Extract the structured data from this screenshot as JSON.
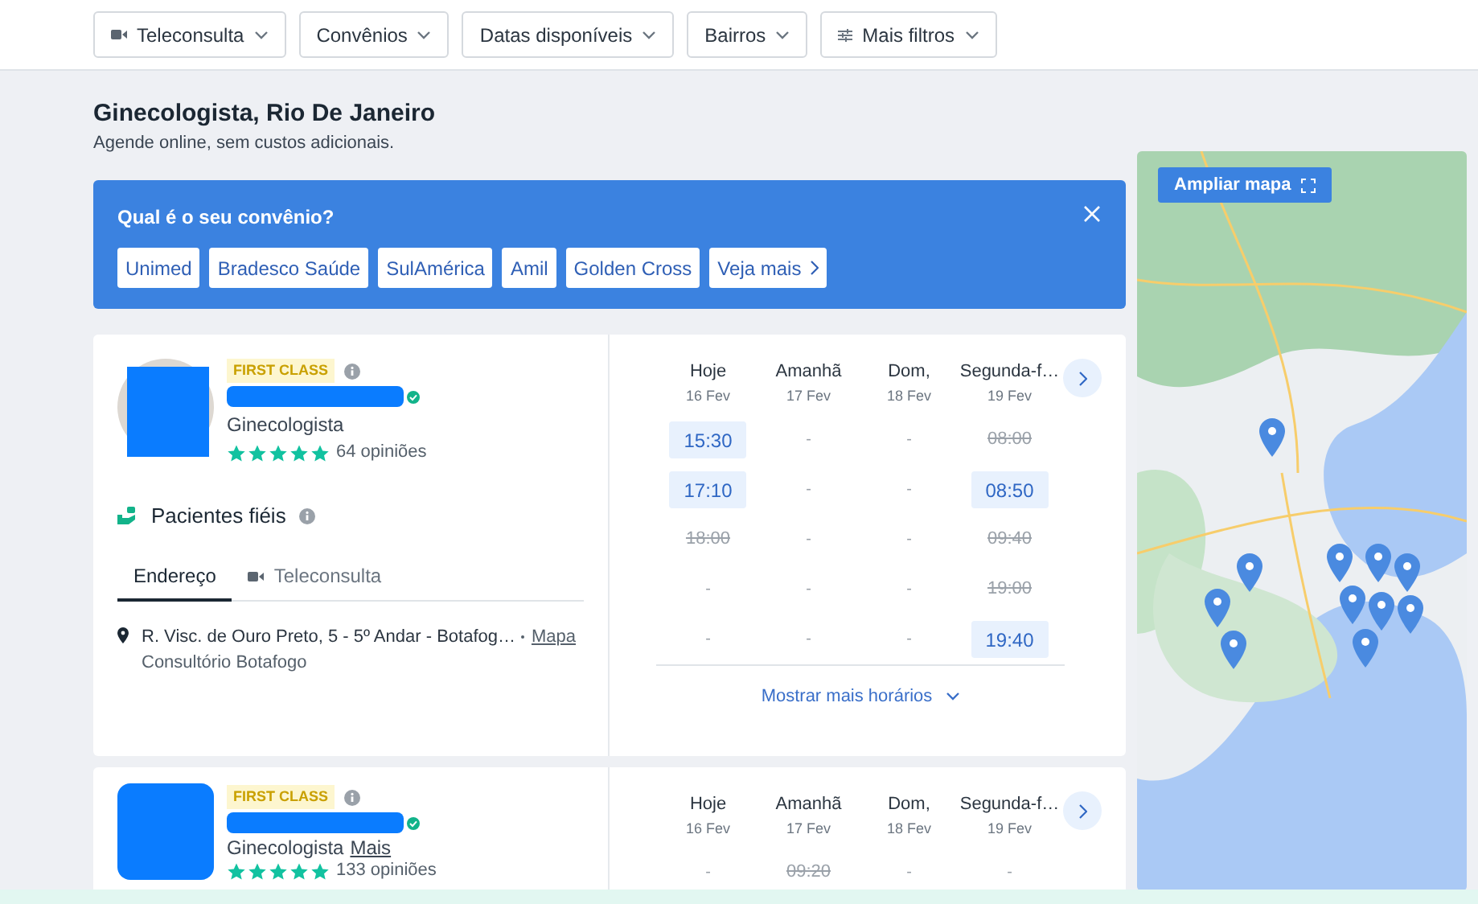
{
  "filters": [
    {
      "label": "Teleconsulta",
      "kind": "video"
    },
    {
      "label": "Convênios",
      "kind": "plain"
    },
    {
      "label": "Datas disponíveis",
      "kind": "plain"
    },
    {
      "label": "Bairros",
      "kind": "plain"
    },
    {
      "label": "Mais filtros",
      "kind": "sliders"
    }
  ],
  "heading": "Ginecologista, Rio De Janeiro",
  "subheading": "Agende online, sem custos adicionais.",
  "insurance_banner": {
    "question": "Qual é o seu convênio?",
    "options": [
      "Unimed",
      "Bradesco Saúde",
      "SulAmérica",
      "Amil",
      "Golden Cross"
    ],
    "more": "Veja mais"
  },
  "doctors": [
    {
      "badge": "FIRST CLASS",
      "specialty": "Ginecologista",
      "stars": 5,
      "reviews": "64 opiniões",
      "loyal": "Pacientes fiéis",
      "tabs": [
        {
          "label": "Endereço",
          "selected": true,
          "kind": "plain"
        },
        {
          "label": "Teleconsulta",
          "selected": false,
          "kind": "video"
        }
      ],
      "address": "R. Visc. de Ouro Preto, 5 - 5º Andar - Botafog…",
      "map_link": "Mapa",
      "clinic": "Consultório Botafogo",
      "days": [
        {
          "label": "Hoje",
          "date": "16 Fev",
          "slots": [
            {
              "text": "15:30",
              "kind": "available"
            },
            {
              "text": "17:10",
              "kind": "available"
            },
            {
              "text": "18:00",
              "kind": "taken"
            },
            {
              "text": "-",
              "kind": "none"
            },
            {
              "text": "-",
              "kind": "none"
            }
          ]
        },
        {
          "label": "Amanhã",
          "date": "17 Fev",
          "slots": [
            {
              "text": "-",
              "kind": "none"
            },
            {
              "text": "-",
              "kind": "none"
            },
            {
              "text": "-",
              "kind": "none"
            },
            {
              "text": "-",
              "kind": "none"
            },
            {
              "text": "-",
              "kind": "none"
            }
          ]
        },
        {
          "label": "Dom,",
          "date": "18 Fev",
          "slots": [
            {
              "text": "-",
              "kind": "none"
            },
            {
              "text": "-",
              "kind": "none"
            },
            {
              "text": "-",
              "kind": "none"
            },
            {
              "text": "-",
              "kind": "none"
            },
            {
              "text": "-",
              "kind": "none"
            }
          ]
        },
        {
          "label": "Segunda-f…",
          "date": "19 Fev",
          "slots": [
            {
              "text": "08:00",
              "kind": "taken"
            },
            {
              "text": "08:50",
              "kind": "available"
            },
            {
              "text": "09:40",
              "kind": "taken"
            },
            {
              "text": "19:00",
              "kind": "taken"
            },
            {
              "text": "19:40",
              "kind": "available"
            }
          ]
        }
      ],
      "show_more": "Mostrar mais horários"
    },
    {
      "badge": "FIRST CLASS",
      "specialty": "Ginecologista",
      "more_link": "Mais",
      "stars": 5,
      "reviews": "133 opiniões",
      "days": [
        {
          "label": "Hoje",
          "date": "16 Fev",
          "slots": [
            {
              "text": "-",
              "kind": "none"
            }
          ]
        },
        {
          "label": "Amanhã",
          "date": "17 Fev",
          "slots": [
            {
              "text": "09:20",
              "kind": "taken"
            }
          ]
        },
        {
          "label": "Dom,",
          "date": "18 Fev",
          "slots": [
            {
              "text": "-",
              "kind": "none"
            }
          ]
        },
        {
          "label": "Segunda-f…",
          "date": "19 Fev",
          "slots": [
            {
              "text": "-",
              "kind": "none"
            }
          ]
        }
      ]
    }
  ],
  "map": {
    "button": "Ampliar mapa"
  }
}
